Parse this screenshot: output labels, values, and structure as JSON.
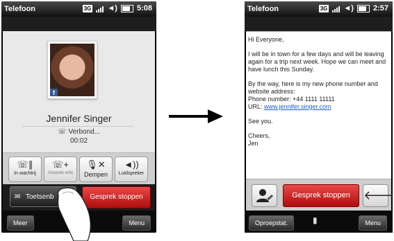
{
  "left_phone": {
    "status_title": "Telefoon",
    "network_badge": "3G",
    "time": "5:08",
    "caller_name": "Jennifer Singer",
    "call_status": "Verbond...",
    "call_timer": "00:02",
    "controls": [
      {
        "label": "In wachtrij",
        "icon": "hold-icon"
      },
      {
        "label": "Gesprek erbij",
        "icon": "add-call-icon"
      },
      {
        "label": "Dempen",
        "icon": "mute-icon"
      },
      {
        "label": "Luidspreker",
        "icon": "speaker-icon"
      }
    ],
    "keypad_label": "Toetsenb",
    "end_call_label": "Gesprek stoppen",
    "softkey_left": "Meer",
    "softkey_right": "Menu",
    "facebook_badge": "f"
  },
  "right_phone": {
    "status_title": "Telefoon",
    "network_badge": "3G",
    "time": "2:57",
    "message": {
      "greeting": "Hi Everyone,",
      "para1": "I will be in town for a few days and will be leaving again for a trip next week. Hope we can meet and have lunch this Sunday.",
      "para2_line1": "By the way, here is my new phone number and website address:",
      "phone_line": "Phone number: +44 1111 11111",
      "url_label": "URL: ",
      "url": "www.jennifer.singer.com",
      "closing": "See you.",
      "signoff": "Cheers,",
      "signature": "Jen"
    },
    "end_call_label": "Gesprek stoppen",
    "softkey_left": "Oproepstat.",
    "softkey_right": "Menu"
  },
  "colors": {
    "end_call_red": "#c81a1a",
    "link_blue": "#1a5fcc",
    "facebook_blue": "#3b5998"
  }
}
